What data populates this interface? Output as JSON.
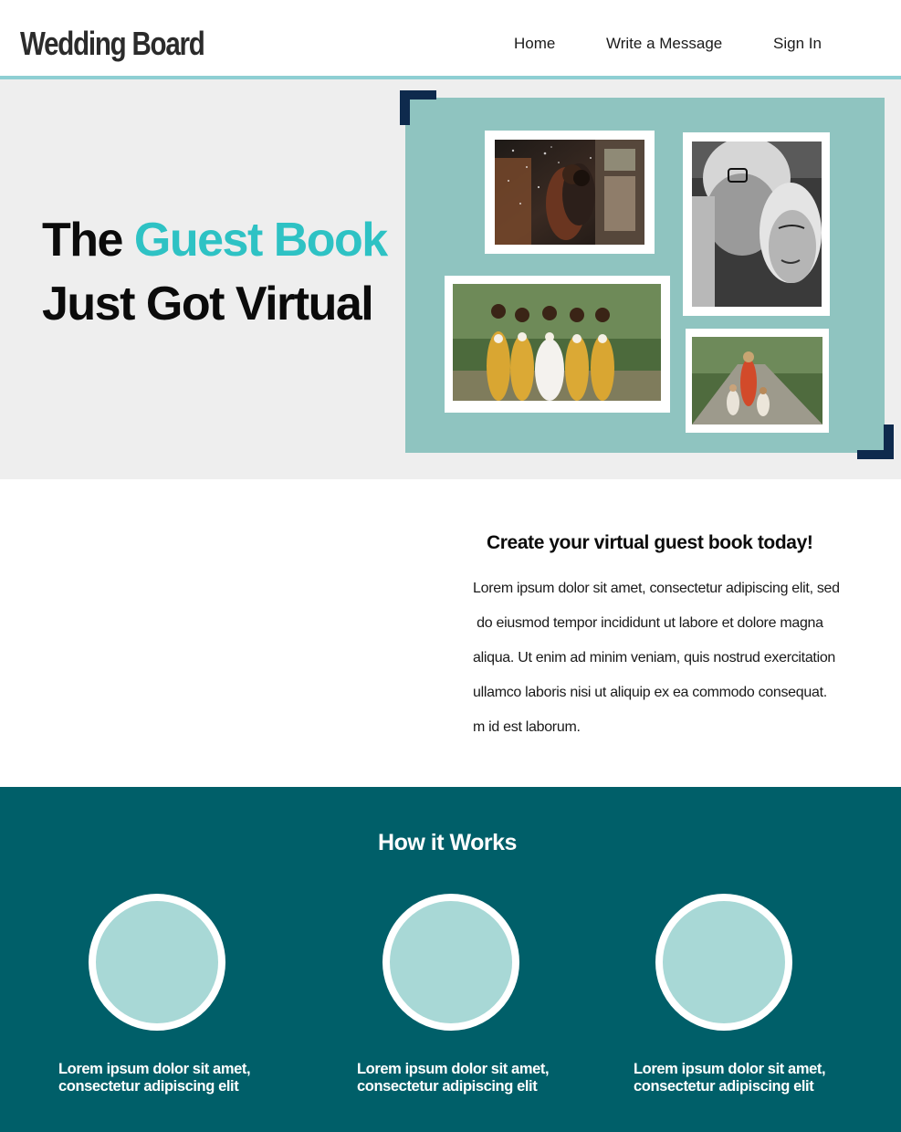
{
  "header": {
    "brand": "Wedding Board",
    "nav": [
      {
        "label": "Home"
      },
      {
        "label": "Write a Message"
      },
      {
        "label": "Sign In"
      }
    ]
  },
  "hero": {
    "title_the": "The ",
    "title_accent": "Guest Book",
    "title_line2": "Just Got Virtual",
    "photos": [
      {
        "icon": "couple-embrace-photo"
      },
      {
        "icon": "elderly-couple-photo"
      },
      {
        "icon": "bridesmaids-photo"
      },
      {
        "icon": "mother-daughters-photo"
      }
    ]
  },
  "intro": {
    "heading": "Create your virtual guest book today!",
    "lines": [
      "Lorem ipsum dolor sit amet, consectetur adipiscing elit, sed",
      " do eiusmod tempor incididunt ut labore et dolore magna",
      "aliqua. Ut enim ad minim veniam, quis nostrud exercitation",
      "ullamco laboris nisi ut aliquip ex ea commodo consequat.",
      "m id est laborum."
    ]
  },
  "how": {
    "title": "How it Works",
    "steps": [
      {
        "line1": "Lorem ipsum dolor sit amet,",
        "line2": "consectetur adipiscing elit"
      },
      {
        "line1": "Lorem ipsum dolor sit amet,",
        "line2": "consectetur adipiscing elit"
      },
      {
        "line1": "Lorem ipsum dolor sit amet,",
        "line2": "consectetur adipiscing elit"
      }
    ]
  },
  "colors": {
    "accent": "#2ec2c4",
    "header_rule": "#8ecfd3",
    "board": "#8fc4c0",
    "corner": "#0e2a4d",
    "how_bg": "#005f69",
    "circle_fill": "#a8d8d6"
  }
}
